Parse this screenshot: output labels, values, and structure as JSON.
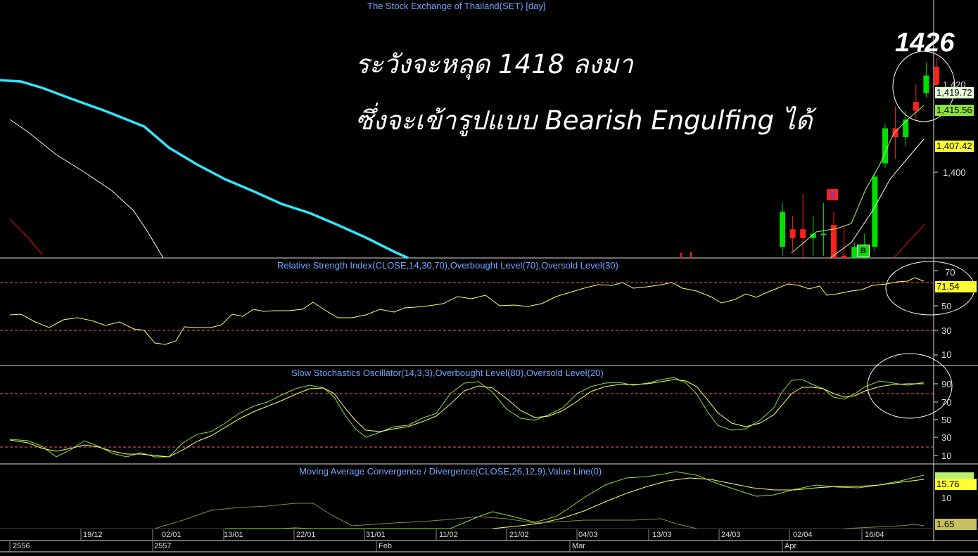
{
  "chart_title": "The Stock Exchange of Thailand(SET) [day]",
  "annotation": {
    "line1": "ระวังจะหลุด 1418 ลงมา",
    "line2": "ซึ่งจะเข้ารูปแบบ Bearish Engulfing ได้",
    "peak_label": "1426"
  },
  "colors": {
    "background": "#000000",
    "up_candle": "#00e000",
    "down_candle": "#ff2020",
    "ma_long": "#33e6ff",
    "ma_mid": "#ffffcc",
    "ma_red": "#e01010",
    "indicator_fast": "#8fe03a",
    "indicator_slow": "#ffff66",
    "level_line": "#ff6060",
    "title_text": "#6fa8ff"
  },
  "price_panel": {
    "y_ticks": [
      "1,420",
      "1,400"
    ],
    "tags": [
      {
        "text": "1,419.72",
        "bg": "#e8ffd8"
      },
      {
        "text": "1,415.56",
        "bg": "#8fe03a"
      },
      {
        "text": "1,407.42",
        "bg": "#ffff33"
      }
    ],
    "signals": [
      {
        "text": "S",
        "bg": "#ff2020",
        "fg": "#3050ff"
      },
      {
        "text": "B",
        "bg": "#00e000",
        "fg": "#000000"
      }
    ]
  },
  "rsi_panel": {
    "title": "Relative Strength Index(CLOSE,14,30,70),Overbought Level(70),Oversold Level(30)",
    "y_ticks": [
      "70",
      "50",
      "30",
      "10"
    ],
    "tag": "71.54"
  },
  "stoch_panel": {
    "title": "Slow Stochastics Oscillator(14,3,3),Overbought Level(80),Oversold Level(20)",
    "y_ticks": [
      "90",
      "70",
      "50",
      "30",
      "10"
    ]
  },
  "macd_panel": {
    "title": "Moving Average Convergence / Divergence(CLOSE,26,12,9),Value Line(0)",
    "y_ticks": [
      "10"
    ],
    "tags": [
      {
        "text": "15.76",
        "bg": "#ffff33"
      },
      {
        "text": "1.65",
        "bg": "#c8c060"
      }
    ]
  },
  "x_axis": {
    "row1": [
      "19/12",
      "02/01",
      "13/01",
      "22/01",
      "31/01",
      "11/02",
      "21/02",
      "04/03",
      "13/03",
      "24/03",
      "02/04",
      "16/04"
    ],
    "row2": [
      "2556",
      "2557",
      "Feb",
      "Mar",
      "Apr"
    ]
  },
  "chart_data": {
    "type": "candlestick",
    "title": "The Stock Exchange of Thailand(SET) [day]",
    "y_range_visible": [
      1380,
      1435
    ],
    "candles_recent": [
      {
        "o": 1383,
        "c": 1391,
        "h": 1393,
        "l": 1381
      },
      {
        "o": 1387,
        "c": 1385,
        "h": 1390,
        "l": 1382
      },
      {
        "o": 1387,
        "c": 1385,
        "h": 1395,
        "l": 1380
      },
      {
        "o": 1385,
        "c": 1386,
        "h": 1390,
        "l": 1381
      },
      {
        "o": 1386,
        "c": 1386,
        "h": 1393,
        "l": 1381
      },
      {
        "o": 1388,
        "c": 1373,
        "h": 1391,
        "l": 1373
      },
      {
        "o": 1381,
        "c": 1379,
        "h": 1388,
        "l": 1377
      },
      {
        "o": 1378,
        "c": 1383,
        "h": 1384,
        "l": 1376
      },
      {
        "o": 1378,
        "c": 1383,
        "h": 1386,
        "l": 1375
      },
      {
        "o": 1383,
        "c": 1399,
        "h": 1400,
        "l": 1382
      },
      {
        "o": 1402,
        "c": 1410,
        "h": 1411,
        "l": 1401
      },
      {
        "o": 1410,
        "c": 1408,
        "h": 1415,
        "l": 1403
      },
      {
        "o": 1408,
        "c": 1412,
        "h": 1414,
        "l": 1406
      },
      {
        "o": 1416,
        "c": 1414,
        "h": 1420,
        "l": 1412
      },
      {
        "o": 1418,
        "c": 1422,
        "h": 1425,
        "l": 1417
      },
      {
        "o": 1424,
        "c": 1420,
        "h": 1426,
        "l": 1418
      }
    ],
    "price_tags": [
      1419.72,
      1415.56,
      1407.42
    ],
    "rsi": {
      "last": 71.54,
      "overbought": 70,
      "oversold": 30,
      "range": [
        0,
        80
      ]
    },
    "stochastic": {
      "overbought": 80,
      "oversold": 20,
      "range": [
        0,
        100
      ]
    },
    "macd": {
      "last": 15.76,
      "histogram_last": 1.65,
      "value_line": 0
    }
  }
}
